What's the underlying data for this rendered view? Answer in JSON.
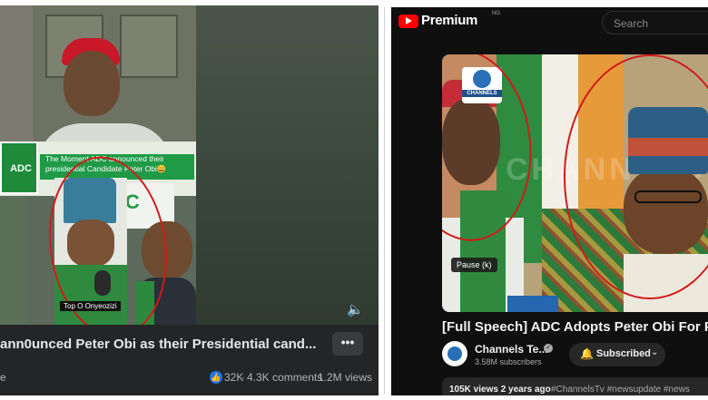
{
  "left": {
    "banner_logo": "ADC",
    "banner_caption": "The Moment ADC announced their presidential Candidate Peter Obi😀",
    "board_text": "DC",
    "name_tag": "Top O Onyeozizi",
    "title": "n0unced Peter Obi as their Presidential cand...",
    "title_prefix": "an",
    "more_label": "•••",
    "stat_left": "e",
    "reactions": "32K",
    "comments": "4.3K comments",
    "views": "1.2M views",
    "dot": "·"
  },
  "right": {
    "brand": "Premium",
    "brand_sup": "NG",
    "search_placeholder": "Search",
    "channel_logo_word": "CHANNELS",
    "watermark": "CHANNELS",
    "pause_label": "Pause (k)",
    "title": "[Full Speech] ADC Adopts Peter Obi For Presid",
    "channel_name": "Channels Te...",
    "subscribers": "3.58M subscribers",
    "subscribed_label": "Subscribed",
    "views_time": "105K views  2 years ago",
    "tags": "#ChannelsTv #newsupdate #news"
  },
  "icons": {
    "youtube_logo": "youtube-logo-icon",
    "sound": "volume-icon",
    "like": "thumbs-up-icon",
    "bell": "bell-icon",
    "verified": "verified-check-icon",
    "chevron": "chevron-down-icon"
  },
  "colors": {
    "facebook_bg": "#242526",
    "youtube_bg": "#0f0f0f",
    "youtube_red": "#ff0000",
    "annotation_red": "#d11a1a",
    "like_blue": "#1877f2"
  }
}
